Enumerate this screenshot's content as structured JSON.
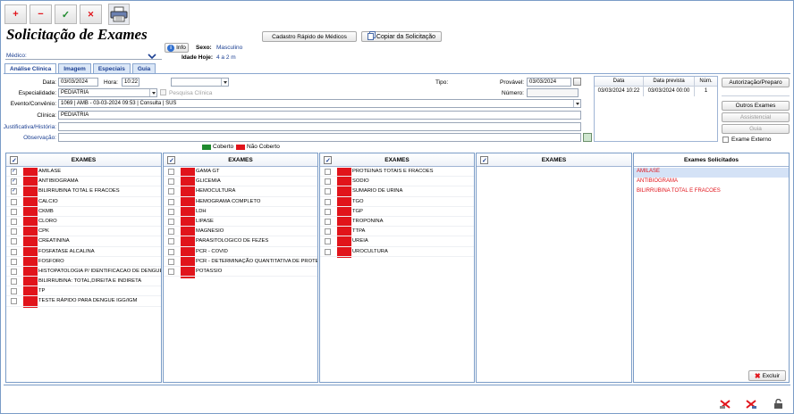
{
  "toolbar": {
    "add": "+",
    "remove": "−",
    "confirm": "✓",
    "cancel": "✕"
  },
  "page_title": "Solicitação de Exames",
  "header": {
    "info_label": "Info",
    "sexo_label": "Sexo:",
    "sexo_value": "Masculino",
    "idade_label": "Idade Hoje:",
    "idade_value": "4 a 2 m",
    "cadastro_button": "Cadastro Rápido de Médicos",
    "copiar_button": "Copiar da Solicitação",
    "medico_label": "Médico:"
  },
  "tabs": [
    "Análise Clínica",
    "Imagem",
    "Especiais",
    "Guia"
  ],
  "form": {
    "data_label": "Data:",
    "data_value": "03/03/2024",
    "hora_label": "Hora:",
    "hora_value": "10:22",
    "tipo_label": "Tipo:",
    "provavel_label": "Provável:",
    "provavel_value": "03/03/2024",
    "especialidade_label": "Especialidade:",
    "especialidade_value": "PEDIATRIA",
    "pesquisa_clinica": "Pesquisa Clínica",
    "numero_label": "Número:",
    "evento_label": "Evento/Convênio:",
    "evento_value": "1069 | AMB - 03-03-2024 09:53 | Consulta | SUS",
    "clinica_label": "Clínica:",
    "clinica_value": "PEDIATRIA",
    "justificativa_label": "Justificativa/História:",
    "observacao_label": "Observação:"
  },
  "legend": {
    "coberto": "Coberto",
    "nao_coberto": "Não Coberto",
    "coberto_color": "#1f8a2e",
    "nao_coberto_color": "#e1141b"
  },
  "date_grid": {
    "headers": [
      "Data",
      "Data prevista",
      "Núm."
    ],
    "rows": [
      [
        "03/03/2024 10:22",
        "03/03/2024 00:00",
        "1"
      ]
    ]
  },
  "side_buttons": {
    "autorizacao": "Autorização/Preparo",
    "outros_exames": "Outros Exames",
    "assistencial": "Assistencial",
    "guia": "Guia",
    "exame_externo": "Exame Externo"
  },
  "panel_header": "EXAMES",
  "columns": [
    [
      {
        "name": "AMILASE",
        "checked": true
      },
      {
        "name": "ANTIBIOGRAMA",
        "checked": true
      },
      {
        "name": "BILIRRUBINA TOTAL E FRACOES",
        "checked": true
      },
      {
        "name": "CALCIO",
        "checked": false
      },
      {
        "name": "CKMB",
        "checked": false
      },
      {
        "name": "CLORO",
        "checked": false
      },
      {
        "name": "CPK",
        "checked": false
      },
      {
        "name": "CREATININA",
        "checked": false
      },
      {
        "name": "FOSFATASE ALCALINA",
        "checked": false
      },
      {
        "name": "FOSFORO",
        "checked": false
      },
      {
        "name": "HISTOPATOLOGIA P/ IDENTIFICACAO DE DENGUE",
        "checked": false
      },
      {
        "name": "BILIRRUBINA: TOTAL,DIREITA E INDIRETA",
        "checked": false
      },
      {
        "name": "TP",
        "checked": false
      },
      {
        "name": "TESTE RÁPIDO PARA DENGUE IGG/IGM",
        "checked": false
      }
    ],
    [
      {
        "name": "GAMA GT",
        "checked": false
      },
      {
        "name": "GLICEMIA",
        "checked": false
      },
      {
        "name": "HEMOCULTURA",
        "checked": false
      },
      {
        "name": "HEMOGRAMA COMPLETO",
        "checked": false
      },
      {
        "name": "LDH",
        "checked": false
      },
      {
        "name": "LIPASE",
        "checked": false
      },
      {
        "name": "MAGNESIO",
        "checked": false
      },
      {
        "name": "PARASITOLOGICO DE FEZES",
        "checked": false
      },
      {
        "name": "PCR - COVID",
        "checked": false
      },
      {
        "name": "PCR - DETERMINAÇÃO QUANTITATIVA DE PROTEINA",
        "checked": false
      },
      {
        "name": "POTASSIO",
        "checked": false
      }
    ],
    [
      {
        "name": "PROTEINAS TOTAIS E FRACOES",
        "checked": false
      },
      {
        "name": "SODIO",
        "checked": false
      },
      {
        "name": "SUMARIO DE URINA",
        "checked": false
      },
      {
        "name": "TGO",
        "checked": false
      },
      {
        "name": "TGP",
        "checked": false
      },
      {
        "name": "TROPONINA",
        "checked": false
      },
      {
        "name": "TTPA",
        "checked": false
      },
      {
        "name": "UREIA",
        "checked": false
      },
      {
        "name": "UROCULTURA",
        "checked": false
      }
    ],
    []
  ],
  "solicitados": {
    "title": "Exames Solicitados",
    "items": [
      "AMILASE",
      "ANTIBIOGRAMA",
      "BILIRRUBINA TOTAL E FRACOES"
    ],
    "excluir_button": "Excluir"
  }
}
